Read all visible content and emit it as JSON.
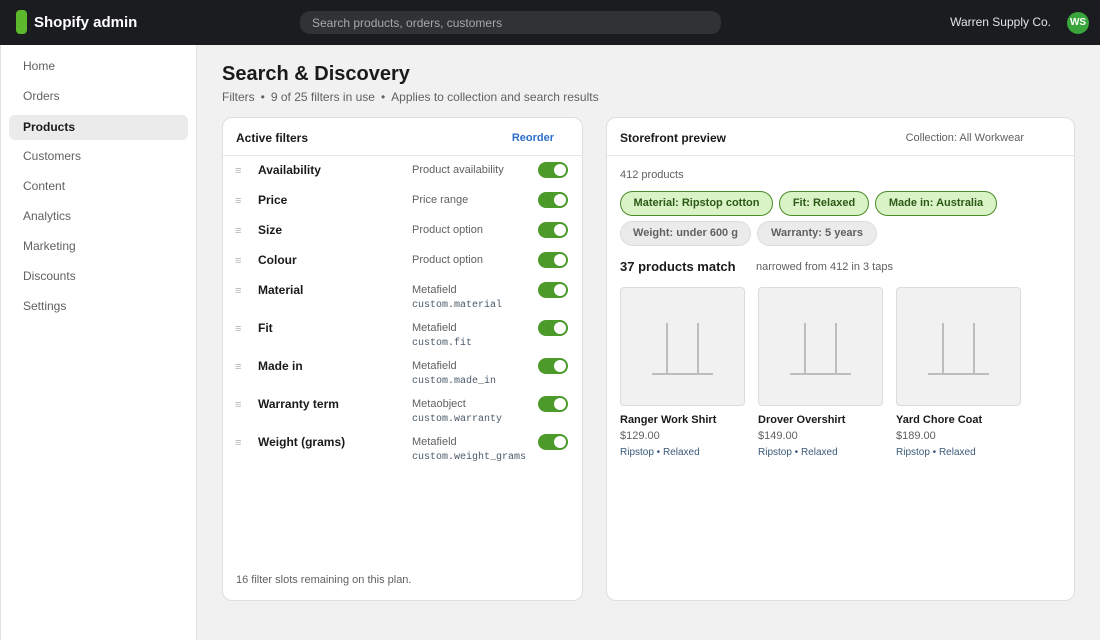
{
  "topbar": {
    "app_name": "Shopify admin",
    "search_placeholder": "Search products, orders, customers",
    "store_name": "Warren Supply Co.",
    "avatar_initials": "WS",
    "logo_icon": "shopify-bag-icon"
  },
  "sidebar": {
    "items": [
      {
        "label": "Home",
        "active": false
      },
      {
        "label": "Orders",
        "active": false
      },
      {
        "label": "Products",
        "active": true
      },
      {
        "label": "Customers",
        "active": false
      },
      {
        "label": "Content",
        "active": false
      },
      {
        "label": "Analytics",
        "active": false
      },
      {
        "label": "Marketing",
        "active": false
      },
      {
        "label": "Discounts",
        "active": false
      },
      {
        "label": "Settings",
        "active": false
      }
    ]
  },
  "page": {
    "title": "Search & Discovery",
    "subtitle": {
      "section": "Filters",
      "usage": "9 of 25 filters in use",
      "scope": "Applies to collection and search results",
      "separator": "•"
    }
  },
  "filters": {
    "title": "Active filters",
    "reorder_label": "Reorder",
    "footer_note": "16 filter slots remaining on this plan.",
    "rows": [
      {
        "name": "Availability",
        "type": "Product availability",
        "key": "",
        "enabled": true
      },
      {
        "name": "Price",
        "type": "Price range",
        "key": "",
        "enabled": true
      },
      {
        "name": "Size",
        "type": "Product option",
        "key": "",
        "enabled": true
      },
      {
        "name": "Colour",
        "type": "Product option",
        "key": "",
        "enabled": true
      },
      {
        "name": "Material",
        "type": "Metafield",
        "key": "custom.material",
        "enabled": true
      },
      {
        "name": "Fit",
        "type": "Metafield",
        "key": "custom.fit",
        "enabled": true
      },
      {
        "name": "Made in",
        "type": "Metafield",
        "key": "custom.made_in",
        "enabled": true
      },
      {
        "name": "Warranty term",
        "type": "Metaobject",
        "key": "custom.warranty",
        "enabled": true
      },
      {
        "name": "Weight (grams)",
        "type": "Metafield",
        "key": "custom.weight_grams",
        "enabled": true
      }
    ]
  },
  "preview": {
    "title": "Storefront preview",
    "collection": "Collection: All Workwear",
    "product_count": "412 products",
    "chips": [
      {
        "label": "Material: Ripstop cotton",
        "selected": true
      },
      {
        "label": "Fit: Relaxed",
        "selected": true
      },
      {
        "label": "Made in: Australia",
        "selected": true
      },
      {
        "label": "Weight: under 600 g",
        "selected": false
      },
      {
        "label": "Warranty: 5 years",
        "selected": false
      }
    ],
    "match_title": "37 products match",
    "narrowed_note": "narrowed from 412 in 3 taps",
    "products": [
      {
        "name": "Ranger Work Shirt",
        "price": "$129.00",
        "attributes": "Ripstop • Relaxed"
      },
      {
        "name": "Drover Overshirt",
        "price": "$149.00",
        "attributes": "Ripstop • Relaxed"
      },
      {
        "name": "Yard Chore Coat",
        "price": "$189.00",
        "attributes": "Ripstop • Relaxed"
      }
    ]
  },
  "colors": {
    "topbar_bg": "#1a1c1f",
    "brand_green": "#5cb82c",
    "toggle_on": "#4b9a2a",
    "link_blue": "#2c6ecb",
    "chip_selected_bg": "#d9f2c6",
    "chip_selected_border": "#4d8a2a"
  }
}
